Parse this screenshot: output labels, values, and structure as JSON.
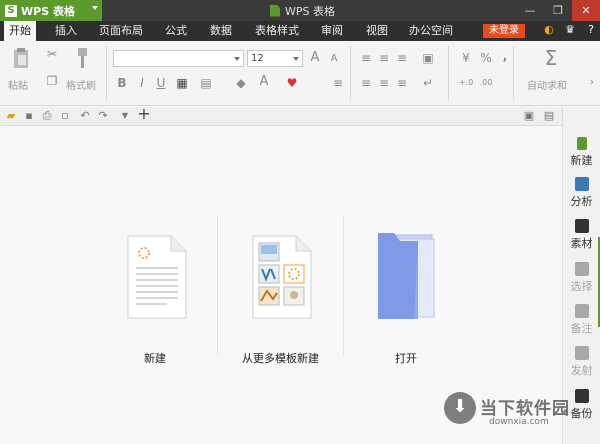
{
  "app": {
    "brand": "WPS 表格",
    "window_title": "WPS 表格",
    "minimize": "—",
    "restore": "❐",
    "close": "✕"
  },
  "tabs": [
    "开始",
    "插入",
    "页面布局",
    "公式",
    "数据",
    "表格样式",
    "审阅",
    "视图",
    "办公空间"
  ],
  "login_label": "未登录",
  "toolbar_right_icons": {
    "skin": "◐",
    "shirt": "♛",
    "help": "?"
  },
  "ribbon": {
    "paste": "粘贴",
    "format_painter": "格式刷",
    "font_size": "12",
    "bold": "B",
    "italic": "I",
    "underline": "U",
    "grow_font": "A",
    "shrink_font": "A",
    "font_color": "A",
    "percent": "%",
    "comma": ",",
    "decimal_inc": "+.0",
    "decimal_dec": ".00",
    "autosum_symbol": "Σ",
    "autosum": "自动求和"
  },
  "quick_access": {
    "add": "+"
  },
  "start_options": [
    {
      "label": "新建"
    },
    {
      "label": "从更多模板新建"
    },
    {
      "label": "打开"
    }
  ],
  "right_panel": [
    {
      "label": "新建",
      "color": "#5c9a2c"
    },
    {
      "label": "分析",
      "color": "#3c78b4"
    },
    {
      "label": "素材",
      "color": "#333333"
    },
    {
      "label": "选择",
      "color": "#a8a8a8"
    },
    {
      "label": "备注",
      "color": "#a8a8a8"
    },
    {
      "label": "发射",
      "color": "#a8a8a8"
    },
    {
      "label": "备份",
      "color": "#333333"
    }
  ],
  "watermark": {
    "text": "当下软件园",
    "url": "downxia.com"
  }
}
